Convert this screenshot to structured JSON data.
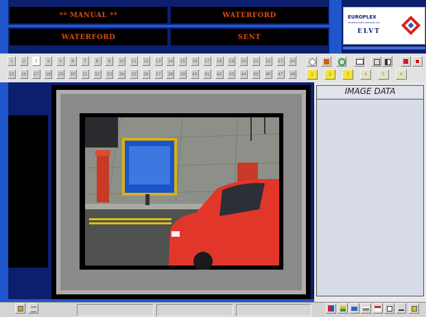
{
  "status": {
    "mode_label": "** MANUAL **",
    "site_top": "WATERFORD",
    "site_bottom": "WATERFORD",
    "state_label": "SENT"
  },
  "logo": {
    "brand": "EUROPLEX",
    "tagline": "TECHNOLOGIES (IRELAND) LTD",
    "product": "ELVT"
  },
  "camera_buttons": {
    "row1": [
      "1",
      "2",
      "3",
      "4",
      "5",
      "6",
      "7",
      "8",
      "9",
      "10",
      "11",
      "12",
      "13",
      "14",
      "15",
      "16",
      "17",
      "18",
      "19",
      "20",
      "21",
      "22",
      "23",
      "24"
    ],
    "row2": [
      "25",
      "26",
      "27",
      "28",
      "29",
      "30",
      "31",
      "32",
      "33",
      "34",
      "35",
      "36",
      "37",
      "38",
      "39",
      "40",
      "41",
      "42",
      "43",
      "44",
      "45",
      "46",
      "47",
      "48"
    ],
    "selected": "3"
  },
  "quick_buttons": {
    "row1": [
      "1",
      "2",
      "3",
      "4",
      "5",
      "6"
    ],
    "row2": [
      "1",
      "2",
      "3",
      "4",
      "5",
      "6"
    ]
  },
  "image_panel": {
    "title": "IMAGE DATA"
  },
  "icons": {
    "toolbar": [
      "eraser-icon",
      "cube-icon",
      "refresh-icon",
      "mail-icon",
      "view-single-icon",
      "view-split-icon",
      "stop-red-icon",
      "record-icon"
    ],
    "taskbar_left": [
      "save-icon",
      "settings-icon"
    ],
    "taskbar_right": [
      "network-icon",
      "chart-icon",
      "camera-icon",
      "print-icon",
      "calendar-icon",
      "window-icon",
      "minimize-icon",
      "exit-icon"
    ]
  },
  "colors": {
    "navy": "#0b1f6e",
    "blue": "#1f56cc",
    "status_text": "#d84a12",
    "panel_grey": "#d8dce8"
  }
}
